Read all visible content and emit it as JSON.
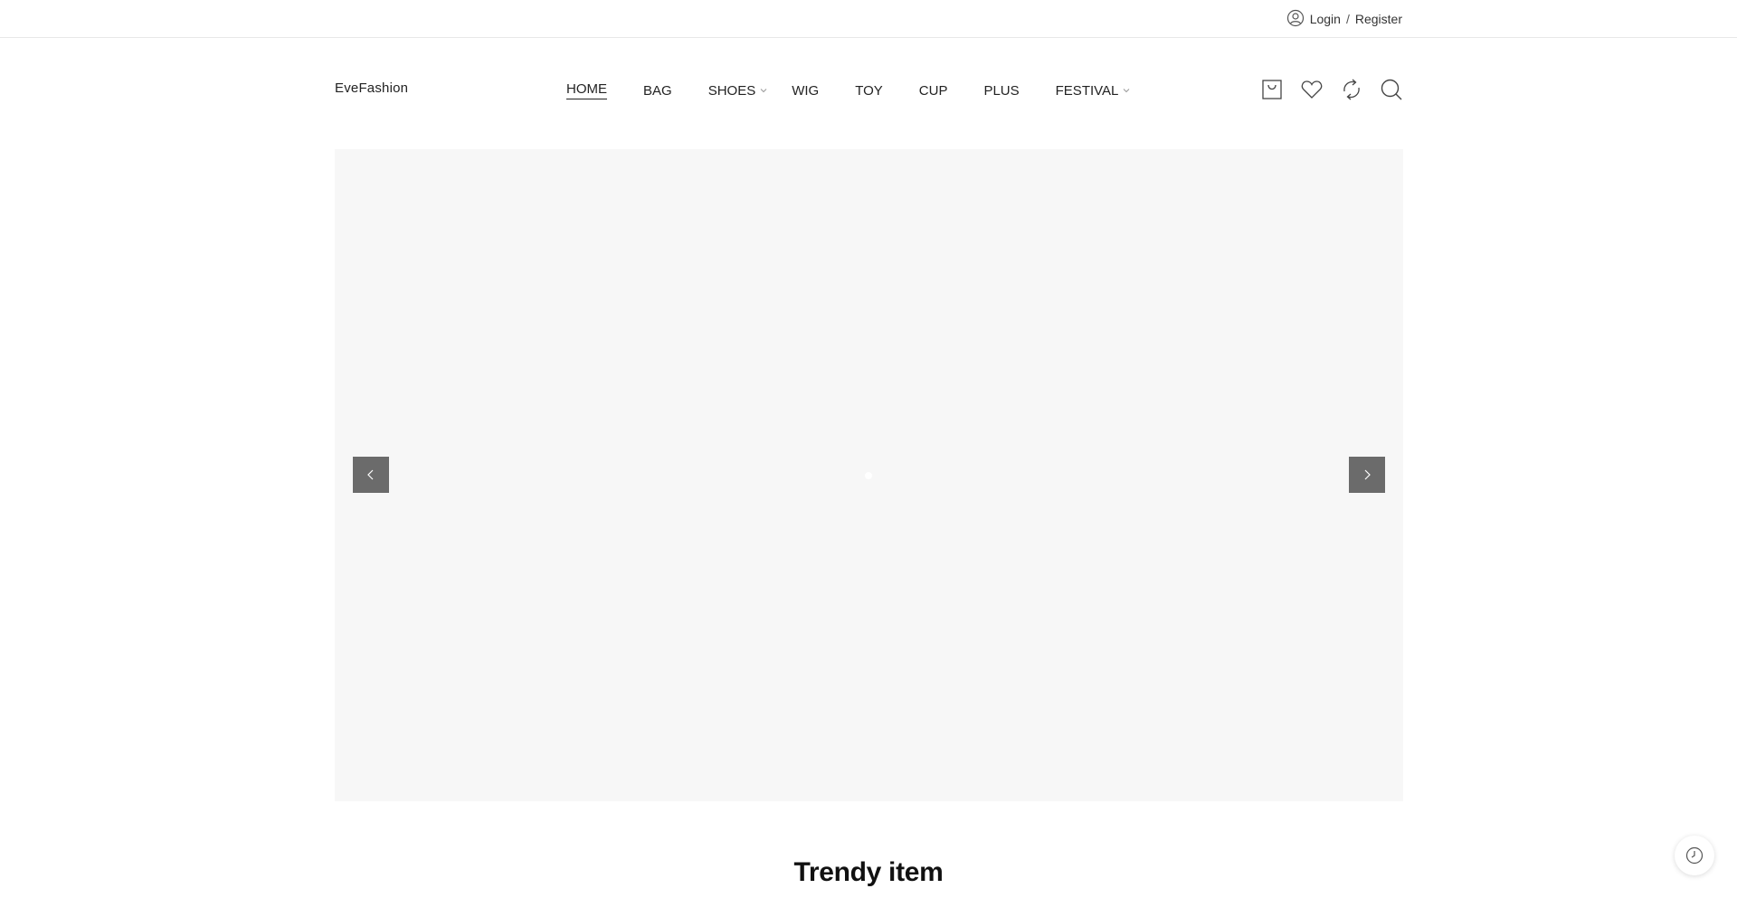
{
  "topbar": {
    "login_label": "Login",
    "separator": "/",
    "register_label": "Register"
  },
  "header": {
    "logo": "EveFashion",
    "nav": [
      {
        "label": "HOME",
        "active": true,
        "has_submenu": false
      },
      {
        "label": "BAG",
        "active": false,
        "has_submenu": false
      },
      {
        "label": "SHOES",
        "active": false,
        "has_submenu": true
      },
      {
        "label": "WIG",
        "active": false,
        "has_submenu": false
      },
      {
        "label": "TOY",
        "active": false,
        "has_submenu": false
      },
      {
        "label": "CUP",
        "active": false,
        "has_submenu": false
      },
      {
        "label": "PLUS",
        "active": false,
        "has_submenu": false
      },
      {
        "label": "FESTIVAL",
        "active": false,
        "has_submenu": true
      }
    ],
    "icons": [
      "cart-icon",
      "heart-icon",
      "compare-icon",
      "search-icon"
    ]
  },
  "hero": {
    "slide_count": 1,
    "active_slide": 1,
    "background": "#f7f7f7",
    "arrow_color": "#6b6b6b"
  },
  "section": {
    "title": "Trendy item"
  },
  "floating": {
    "history_icon": "history-icon"
  }
}
